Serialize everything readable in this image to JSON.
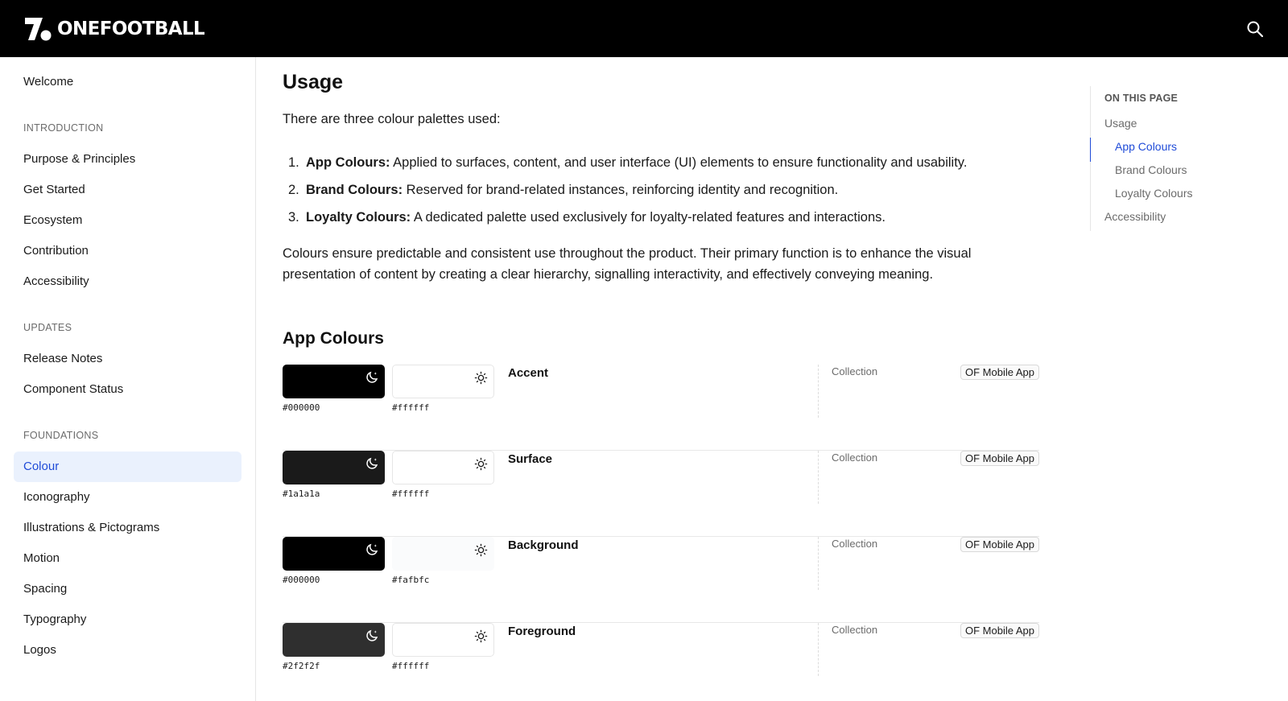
{
  "header": {
    "brand": "ONEFOOTBALL",
    "search_icon": "search-icon"
  },
  "sidebar": {
    "welcome": "Welcome",
    "sections": [
      {
        "title": "INTRODUCTION",
        "items": [
          "Purpose & Principles",
          "Get Started",
          "Ecosystem",
          "Contribution",
          "Accessibility"
        ]
      },
      {
        "title": "UPDATES",
        "items": [
          "Release Notes",
          "Component Status"
        ]
      },
      {
        "title": "FOUNDATIONS",
        "items": [
          "Colour",
          "Iconography",
          "Illustrations & Pictograms",
          "Motion",
          "Spacing",
          "Typography",
          "Logos"
        ]
      }
    ],
    "active_item": "Colour"
  },
  "main": {
    "title": "Usage",
    "intro": "There are three colour palettes used:",
    "list": [
      {
        "num": "1.",
        "term": "App Colours:",
        "text": " Applied to surfaces, content, and user interface (UI) elements to ensure functionality and usability."
      },
      {
        "num": "2.",
        "term": "Brand Colours:",
        "text": " Reserved for brand-related instances, reinforcing identity and recognition."
      },
      {
        "num": "3.",
        "term": "Loyalty Colours:",
        "text": " A dedicated palette used exclusively for loyalty-related features and interactions."
      }
    ],
    "paragraph": "Colours ensure predictable and consistent use throughout the product. Their primary function is to enhance the visual presentation of content by creating a clear hierarchy, signalling interactivity, and effectively conveying meaning.",
    "app_colours_title": "App Colours",
    "tokens": [
      {
        "name": "Accent",
        "dark_hex": "#000000",
        "light_hex": "#ffffff",
        "dark_color": "#000000",
        "light_color": "#ffffff",
        "collection_label": "Collection",
        "collection": "OF Mobile App"
      },
      {
        "name": "Surface",
        "dark_hex": "#1a1a1a",
        "light_hex": "#ffffff",
        "dark_color": "#1a1a1a",
        "light_color": "#ffffff",
        "collection_label": "Collection",
        "collection": "OF Mobile App"
      },
      {
        "name": "Background",
        "dark_hex": "#000000",
        "light_hex": "#fafbfc",
        "dark_color": "#000000",
        "light_color": "#fafbfc",
        "collection_label": "Collection",
        "collection": "OF Mobile App"
      },
      {
        "name": "Foreground",
        "dark_hex": "#2f2f2f",
        "light_hex": "#ffffff",
        "dark_color": "#2f2f2f",
        "light_color": "#ffffff",
        "collection_label": "Collection",
        "collection": "OF Mobile App"
      }
    ]
  },
  "toc": {
    "title": "ON THIS PAGE",
    "items": [
      {
        "label": "Usage",
        "level": 1
      },
      {
        "label": "App Colours",
        "level": 2,
        "active": true
      },
      {
        "label": "Brand Colours",
        "level": 2
      },
      {
        "label": "Loyalty Colours",
        "level": 2
      },
      {
        "label": "Accessibility",
        "level": 1
      }
    ]
  },
  "colors": {
    "header_bg": "#000000",
    "accent_blue": "#1f4bd8",
    "active_bg": "#eaf1fd"
  }
}
